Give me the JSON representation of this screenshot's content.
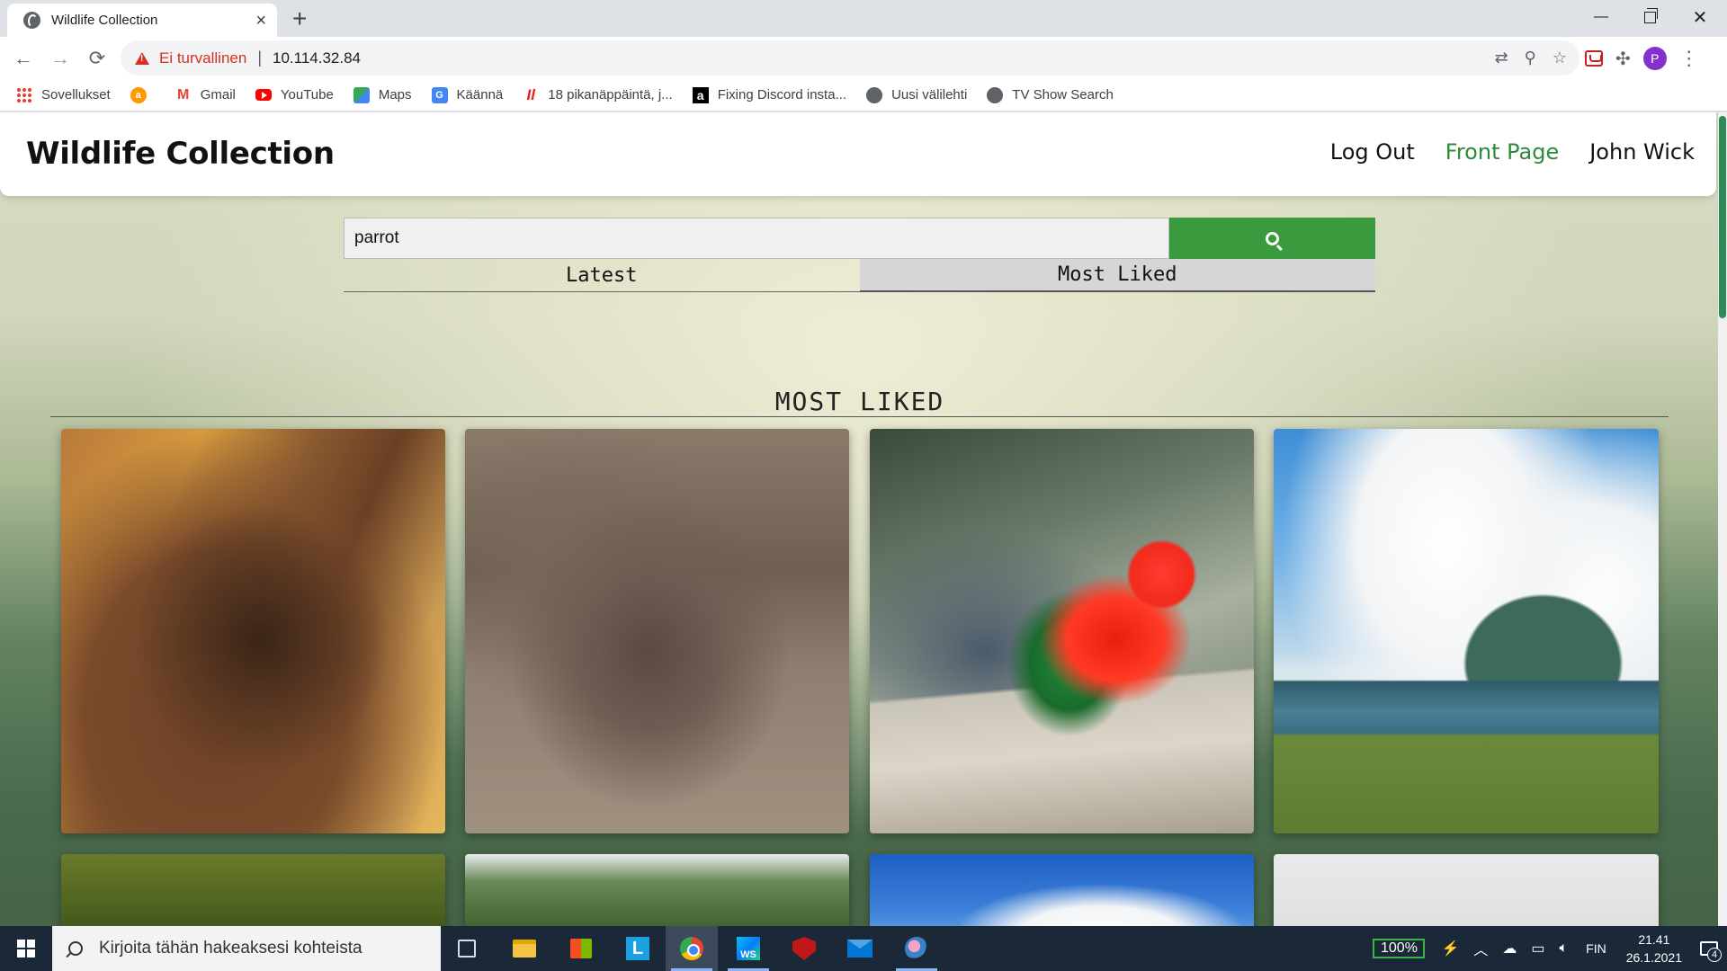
{
  "browser": {
    "tab": {
      "title": "Wildlife Collection",
      "close": "×"
    },
    "new_tab": "+",
    "window_controls": {
      "minimize": "—",
      "close": "✕"
    },
    "nav": {
      "back": "←",
      "forward": "→",
      "reload": "⟳"
    },
    "address": {
      "security_label": "Ei turvallinen",
      "separator": "|",
      "url": "10.114.32.84"
    },
    "profile_initial": "P",
    "bookmarks": [
      {
        "label": "Sovellukset",
        "icon": "apps-grid-icon"
      },
      {
        "label": "",
        "icon": "amazon-icon"
      },
      {
        "label": "Gmail",
        "icon": "gmail-icon"
      },
      {
        "label": "YouTube",
        "icon": "youtube-icon"
      },
      {
        "label": "Maps",
        "icon": "maps-icon"
      },
      {
        "label": "Käännä",
        "icon": "translate-icon"
      },
      {
        "label": "18 pikanäppäintä, j...",
        "icon": "n-icon"
      },
      {
        "label": "Fixing Discord insta...",
        "icon": "a-icon"
      },
      {
        "label": "Uusi välilehti",
        "icon": "globe-icon"
      },
      {
        "label": "TV Show Search",
        "icon": "globe-icon"
      }
    ]
  },
  "site": {
    "title": "Wildlife Collection",
    "nav": {
      "logout": "Log Out",
      "front_page": "Front Page",
      "user": "John Wick"
    },
    "search": {
      "value": "parrot",
      "placeholder": ""
    },
    "tabs": {
      "latest": "Latest",
      "most_liked": "Most Liked",
      "active": "most_liked"
    },
    "section_title": "MOST LIKED",
    "images": [
      {
        "subject": "gorilla"
      },
      {
        "subject": "kangaroo"
      },
      {
        "subject": "red parrot on wooden fence"
      },
      {
        "subject": "lake landscape with horses"
      },
      {
        "subject": "green blur"
      },
      {
        "subject": "tree canopy"
      },
      {
        "subject": "blue sky with clouds"
      },
      {
        "subject": "pale sky"
      }
    ],
    "accent_color": "#3a9b3e"
  },
  "taskbar": {
    "search_placeholder": "Kirjoita tähän hakeaksesi kohteista",
    "battery": "100%",
    "language": "FIN",
    "time": "21.41",
    "date": "26.1.2021",
    "notifications": "4",
    "apps": [
      "task-view-icon",
      "file-explorer-icon",
      "store-icon",
      "l-app-icon",
      "chrome-icon",
      "webstorm-icon",
      "mcafee-icon",
      "mail-icon",
      "snip-icon"
    ]
  }
}
